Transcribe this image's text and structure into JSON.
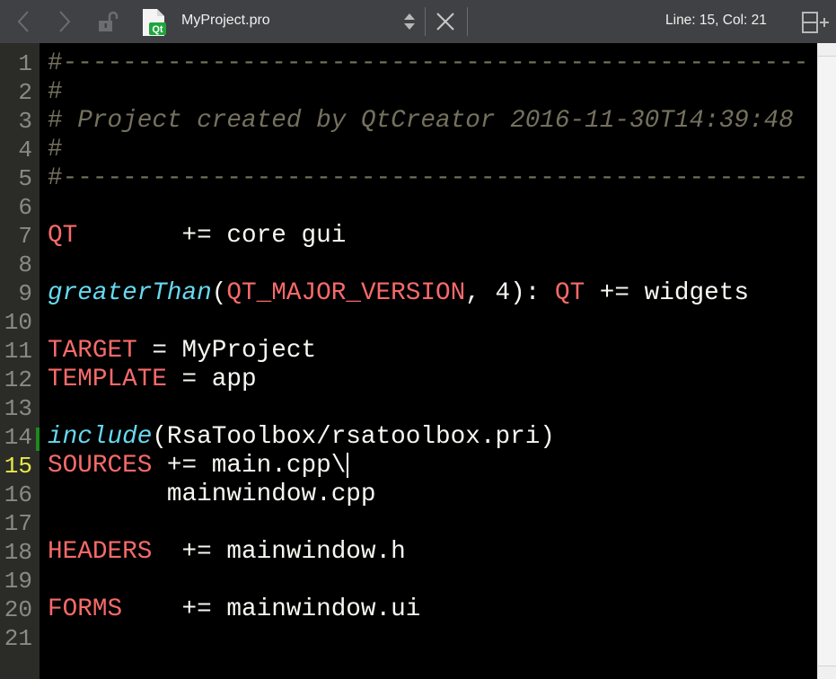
{
  "toolbar": {
    "back_icon": "chevron-left-icon",
    "forward_icon": "chevron-right-icon",
    "lock_icon": "unlocked-icon",
    "file_icon": "qt-file-icon",
    "file_icon_badge": "Qt",
    "file_name": "MyProject.pro",
    "switch_icon": "up-down-arrows-icon",
    "close_icon": "close-icon",
    "cursor_position": "Line: 15, Col: 21",
    "split_icon": "split-add-icon"
  },
  "editor": {
    "current_line": 15,
    "colors": {
      "comment": "#75715e",
      "variable": "#f86a6a",
      "function": "#66d9ef",
      "text": "#f8f8f2",
      "current_line_number": "#e8e84a",
      "modified_marker": "#1e8a1e"
    },
    "lines": [
      {
        "n": "1",
        "tokens": [
          {
            "t": "#--------------------------------------------------",
            "c": "comment",
            "nostyle": true
          }
        ]
      },
      {
        "n": "2",
        "tokens": [
          {
            "t": "#",
            "c": "comment",
            "nostyle": true
          }
        ]
      },
      {
        "n": "3",
        "tokens": [
          {
            "t": "#",
            "c": "comment",
            "nostyle": true
          },
          {
            "t": " Project created by QtCreator 2016-11-30T14:39:48",
            "c": "comment"
          }
        ]
      },
      {
        "n": "4",
        "tokens": [
          {
            "t": "#",
            "c": "comment",
            "nostyle": true
          }
        ]
      },
      {
        "n": "5",
        "tokens": [
          {
            "t": "#--------------------------------------------------",
            "c": "comment",
            "nostyle": true
          }
        ]
      },
      {
        "n": "6",
        "tokens": []
      },
      {
        "n": "7",
        "tokens": [
          {
            "t": "QT",
            "c": "var"
          },
          {
            "t": "       += core gui",
            "c": "plain"
          }
        ]
      },
      {
        "n": "8",
        "tokens": []
      },
      {
        "n": "9",
        "tokens": [
          {
            "t": "greaterThan",
            "c": "func"
          },
          {
            "t": "(",
            "c": "plain"
          },
          {
            "t": "QT_MAJOR_VERSION",
            "c": "var"
          },
          {
            "t": ", 4): ",
            "c": "plain"
          },
          {
            "t": "QT",
            "c": "var"
          },
          {
            "t": " += widgets",
            "c": "plain"
          }
        ]
      },
      {
        "n": "10",
        "tokens": []
      },
      {
        "n": "11",
        "tokens": [
          {
            "t": "TARGET",
            "c": "var"
          },
          {
            "t": " = MyProject",
            "c": "plain"
          }
        ]
      },
      {
        "n": "12",
        "tokens": [
          {
            "t": "TEMPLATE",
            "c": "var"
          },
          {
            "t": " = app",
            "c": "plain"
          }
        ]
      },
      {
        "n": "13",
        "tokens": []
      },
      {
        "n": "14",
        "tokens": [
          {
            "t": "include",
            "c": "func"
          },
          {
            "t": "(RsaToolbox/rsatoolbox.pri)",
            "c": "plain"
          }
        ]
      },
      {
        "n": "15",
        "tokens": [
          {
            "t": "SOURCES",
            "c": "var"
          },
          {
            "t": " += main.cpp\\",
            "c": "plain"
          }
        ],
        "cursor": true
      },
      {
        "n": "16",
        "tokens": [
          {
            "t": "        mainwindow.cpp",
            "c": "plain"
          }
        ]
      },
      {
        "n": "17",
        "tokens": []
      },
      {
        "n": "18",
        "tokens": [
          {
            "t": "HEADERS",
            "c": "var"
          },
          {
            "t": "  += mainwindow.h",
            "c": "plain"
          }
        ]
      },
      {
        "n": "19",
        "tokens": []
      },
      {
        "n": "20",
        "tokens": [
          {
            "t": "FORMS",
            "c": "var"
          },
          {
            "t": "    += mainwindow.ui",
            "c": "plain"
          }
        ]
      },
      {
        "n": "21",
        "tokens": []
      }
    ]
  }
}
